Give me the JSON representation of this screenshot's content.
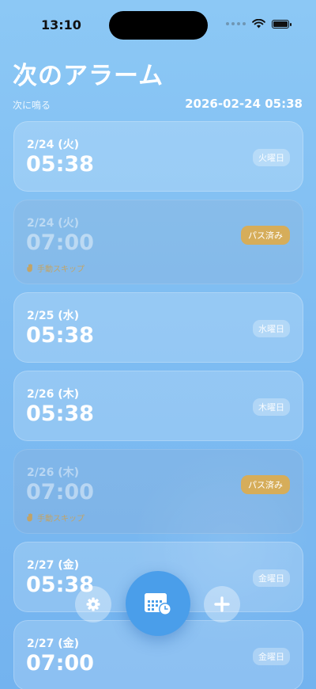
{
  "status_bar": {
    "time": "13:10"
  },
  "header": {
    "title": "次のアラーム",
    "subtitle": "次に鳴る",
    "next_alarm": "2026-02-24 05:38"
  },
  "alarms": [
    {
      "date": "2/24 (火)",
      "time": "05:38",
      "badge": "火曜日",
      "skipped": false
    },
    {
      "date": "2/24 (火)",
      "time": "07:00",
      "badge": "パス済み",
      "skipped": true,
      "note": "手動スキップ"
    },
    {
      "date": "2/25 (水)",
      "time": "05:38",
      "badge": "水曜日",
      "skipped": false
    },
    {
      "date": "2/26 (木)",
      "time": "05:38",
      "badge": "木曜日",
      "skipped": false
    },
    {
      "date": "2/26 (木)",
      "time": "07:00",
      "badge": "パス済み",
      "skipped": true,
      "note": "手動スキップ"
    },
    {
      "date": "2/27 (金)",
      "time": "05:38",
      "badge": "金曜日",
      "skipped": false
    },
    {
      "date": "2/27 (金)",
      "time": "07:00",
      "badge": "金曜日",
      "skipped": false
    }
  ],
  "colors": {
    "background": "#80bef2",
    "pass_badge": "#d6ad5a",
    "main_button": "#4a9eea"
  },
  "icons": {
    "settings": "gear-icon",
    "schedule": "calendar-clock-icon",
    "add": "plus-icon"
  }
}
